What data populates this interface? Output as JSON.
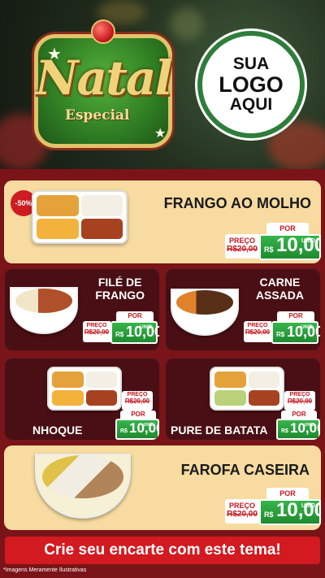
{
  "header": {
    "badge_main": "Natal",
    "badge_sub": "Especial",
    "logo_lines": [
      "SUA",
      "LOGO",
      "AQUI"
    ]
  },
  "products": [
    {
      "name": "FRANGO AO MOLHO",
      "discount": "-50%",
      "por": "POR",
      "preco": "PREÇO",
      "old": "R$20,00",
      "currency": "R$",
      "price": "10,00",
      "unit": "UNID"
    },
    {
      "name_lines": [
        "FILÉ DE",
        "FRANGO"
      ],
      "por": "POR",
      "preco": "PREÇO",
      "old": "R$20,00",
      "currency": "R$",
      "price": "10,00",
      "unit": "UNID"
    },
    {
      "name_lines": [
        "CARNE",
        "ASSADA"
      ],
      "por": "POR",
      "preco": "PREÇO",
      "old": "R$20,00",
      "currency": "R$",
      "price": "10,00",
      "unit": "UNID"
    },
    {
      "name": "NHOQUE",
      "por": "POR",
      "preco": "PREÇO",
      "old": "R$20,00",
      "currency": "R$",
      "price": "10,00",
      "unit": "UNID"
    },
    {
      "name": "PURE DE BATATA",
      "por": "POR",
      "preco": "PREÇO",
      "old": "R$20,00",
      "currency": "R$",
      "price": "10,00",
      "unit": "UNID"
    },
    {
      "name": "FAROFA CASEIRA",
      "por": "POR",
      "preco": "PREÇO",
      "old": "R$20,00",
      "currency": "R$",
      "price": "10,00",
      "unit": "UNID"
    }
  ],
  "footer": {
    "cta": "Crie seu encarte com este tema!",
    "note": "*Imagens Meramente Ilustrativas"
  },
  "colors": {
    "red": "#d21a20",
    "green": "#2e9e3f",
    "cream": "#f7dba0",
    "dark_card": "#4a0f14"
  }
}
